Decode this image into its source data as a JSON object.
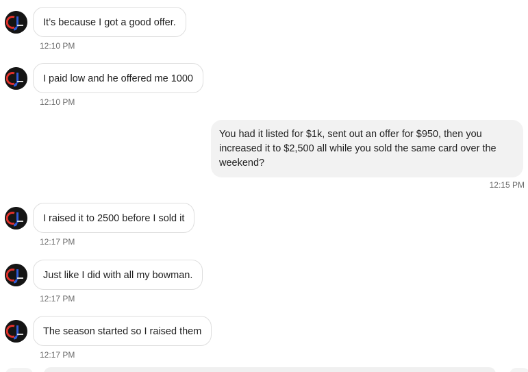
{
  "messages": [
    {
      "direction": "incoming",
      "text": "It’s because I got a good offer.",
      "time": "12:10 PM"
    },
    {
      "direction": "incoming",
      "text": "I paid low and he offered me 1000",
      "time": "12:10 PM"
    },
    {
      "direction": "outgoing",
      "text": "You had it listed for $1k, sent out an offer for $950, then you increased it to $2,500 all while you sold the same card over the weekend?",
      "time": "12:15 PM"
    },
    {
      "direction": "incoming",
      "text": "I raised it to 2500 before I sold it",
      "time": "12:17 PM"
    },
    {
      "direction": "incoming",
      "text": "Just like I did with all my bowman.",
      "time": "12:17 PM"
    },
    {
      "direction": "incoming",
      "text": "The season started so I raised them",
      "time": "12:17 PM"
    }
  ],
  "avatar_icon": "sender-avatar-logo",
  "colors": {
    "incoming_bubble_bg": "#ffffff",
    "incoming_bubble_border": "#dedede",
    "outgoing_bubble_bg": "#f2f2f2",
    "timestamp": "#6b6b6b",
    "avatar_red": "#e0312b",
    "avatar_blue": "#2f5bd6"
  }
}
